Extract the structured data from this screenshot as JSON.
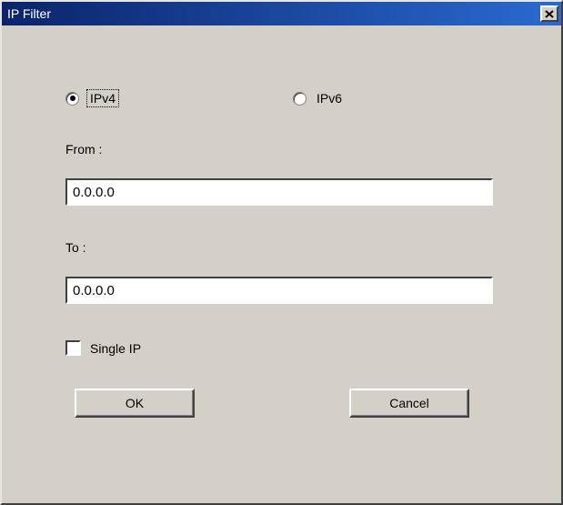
{
  "window": {
    "title": "IP Filter"
  },
  "radios": {
    "ipv4_label": "IPv4",
    "ipv6_label": "IPv6"
  },
  "fields": {
    "from_label": "From :",
    "from_value": "0.0.0.0",
    "to_label": "To :",
    "to_value": "0.0.0.0"
  },
  "checkbox": {
    "single_ip_label": "Single IP"
  },
  "buttons": {
    "ok": "OK",
    "cancel": "Cancel"
  }
}
